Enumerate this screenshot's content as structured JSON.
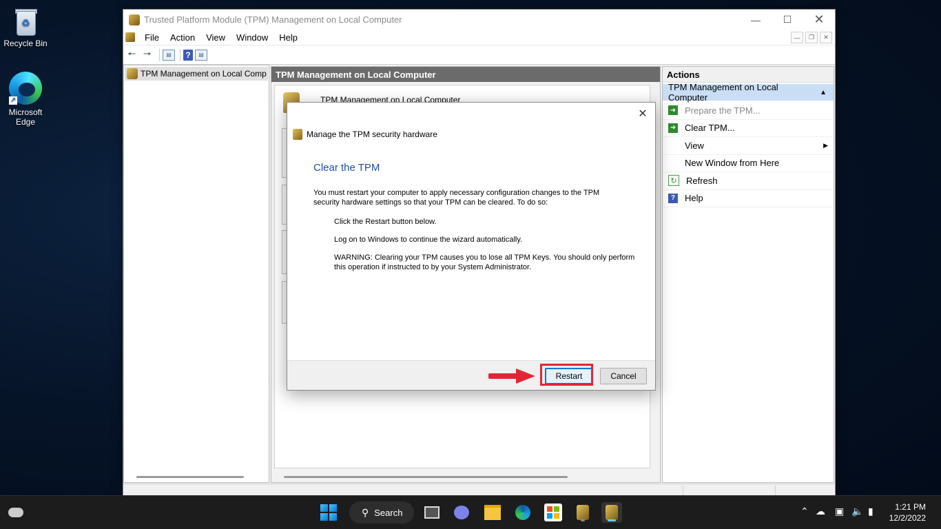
{
  "desktop": {
    "icons": [
      {
        "label": "Recycle Bin"
      },
      {
        "label": "Microsoft Edge"
      }
    ]
  },
  "window": {
    "title": "Trusted Platform Module (TPM) Management on Local Computer",
    "menu": [
      "File",
      "Action",
      "View",
      "Window",
      "Help"
    ],
    "tree": {
      "item": "TPM Management on Local Comp"
    },
    "center": {
      "header": "TPM Management on Local Computer",
      "content_title": "TPM Management on Local Computer"
    },
    "actions": {
      "header": "Actions",
      "section": "TPM Management on Local Computer",
      "items": [
        {
          "label": "Prepare the TPM...",
          "icon": "green-arrow-icon",
          "disabled": true
        },
        {
          "label": "Clear TPM...",
          "icon": "green-arrow-icon",
          "disabled": false
        },
        {
          "label": "View",
          "icon": "",
          "submenu": true
        },
        {
          "label": "New Window from Here",
          "icon": ""
        },
        {
          "label": "Refresh",
          "icon": "refresh-icon"
        },
        {
          "label": "Help",
          "icon": "help-icon"
        }
      ]
    }
  },
  "dialog": {
    "header": "Manage the TPM security hardware",
    "title": "Clear the TPM",
    "intro": "You must restart your computer to apply necessary configuration changes to the TPM security hardware settings so that your TPM can be cleared. To do so:",
    "steps": [
      "Click the Restart button below.",
      "Log on to Windows to continue the wizard automatically.",
      "WARNING: Clearing your TPM causes you to lose all TPM Keys. You should only perform this operation if instructed to by your System Administrator."
    ],
    "buttons": {
      "restart": "Restart",
      "cancel": "Cancel"
    },
    "highlight_color": "#e32636"
  },
  "taskbar": {
    "search_label": "Search",
    "time": "1:21 PM",
    "date": "12/2/2022"
  }
}
